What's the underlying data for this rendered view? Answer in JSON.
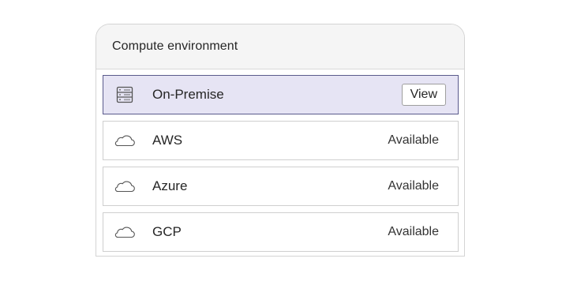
{
  "panel": {
    "title": "Compute environment"
  },
  "environments": [
    {
      "name": "On-Premise",
      "icon": "server-rack-icon",
      "action_label": "View",
      "selected": true
    },
    {
      "name": "AWS",
      "icon": "cloud-icon",
      "status": "Available"
    },
    {
      "name": "Azure",
      "icon": "cloud-icon",
      "status": "Available"
    },
    {
      "name": "GCP",
      "icon": "cloud-icon",
      "status": "Available"
    }
  ],
  "colors": {
    "selected_background": "#e6e4f4",
    "selected_border": "#5a5a8c",
    "header_background": "#f5f5f5"
  }
}
